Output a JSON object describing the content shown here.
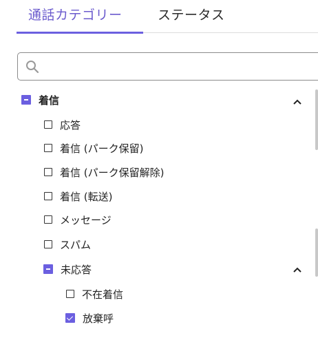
{
  "tabs": [
    {
      "label": "通話カテゴリー",
      "active": true
    },
    {
      "label": "ステータス",
      "active": false
    }
  ],
  "search": {
    "value": "",
    "placeholder": ""
  },
  "tree": {
    "incoming": {
      "label": "着信",
      "state": "indeterminate",
      "expanded": true
    },
    "answered": {
      "label": "応答",
      "state": "unchecked"
    },
    "parked": {
      "label": "着信 (パーク保留)",
      "state": "unchecked"
    },
    "unparked": {
      "label": "着信 (パーク保留解除)",
      "state": "unchecked"
    },
    "transferred": {
      "label": "着信 (転送)",
      "state": "unchecked"
    },
    "message": {
      "label": "メッセージ",
      "state": "unchecked"
    },
    "spam": {
      "label": "スパム",
      "state": "unchecked"
    },
    "unanswered": {
      "label": "未応答",
      "state": "indeterminate",
      "expanded": true
    },
    "missed": {
      "label": "不在着信",
      "state": "unchecked"
    },
    "abandoned": {
      "label": "放棄呼",
      "state": "checked"
    }
  },
  "colors": {
    "accent": "#6b5fe0"
  }
}
